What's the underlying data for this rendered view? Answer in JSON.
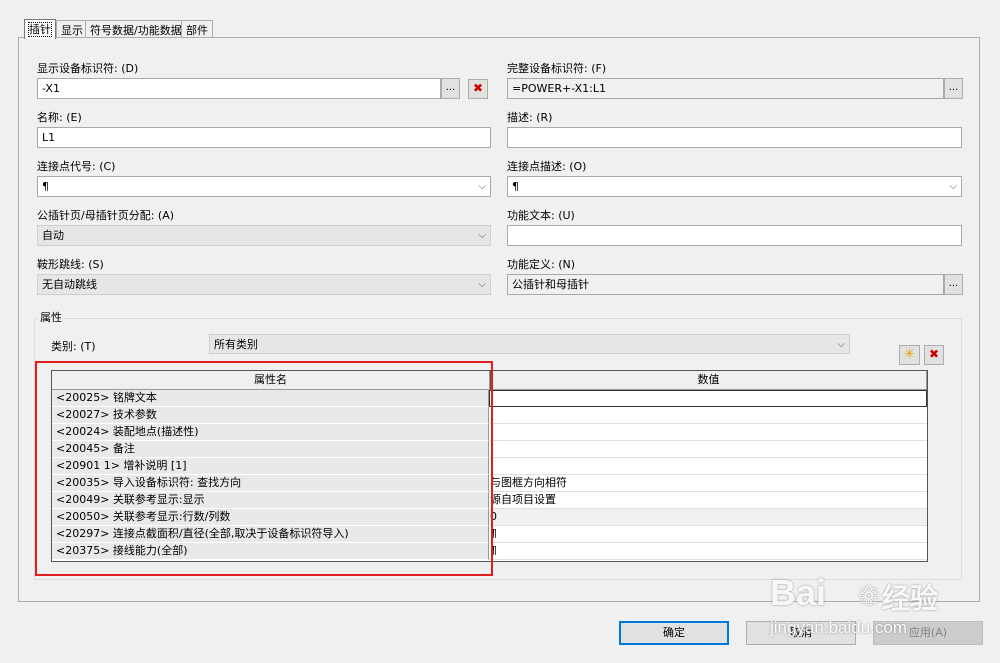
{
  "tabs": [
    "插针",
    "显示",
    "符号数据/功能数据",
    "部件"
  ],
  "fields": {
    "display_id": {
      "label": "显示设备标识符: (D)",
      "value": "-X1"
    },
    "full_id": {
      "label": "完整设备标识符: (F)",
      "value": "=POWER+-X1:L1"
    },
    "name": {
      "label": "名称: (E)",
      "value": "L1"
    },
    "description": {
      "label": "描述: (R)",
      "value": ""
    },
    "conn_code": {
      "label": "连接点代号: (C)",
      "value": "¶"
    },
    "conn_desc": {
      "label": "连接点描述: (O)",
      "value": "¶"
    },
    "page_assign": {
      "label": "公插针页/母插针页分配: (A)",
      "value": "自动"
    },
    "func_text": {
      "label": "功能文本: (U)",
      "value": ""
    },
    "jumper": {
      "label": "鞍形跳线: (S)",
      "value": "无自动跳线"
    },
    "func_def": {
      "label": "功能定义: (N)",
      "value": "公插针和母插针"
    }
  },
  "browse_label": "...",
  "delete_glyph": "✖",
  "new_glyph": "✳",
  "properties": {
    "group_title": "属性",
    "category_label": "类别: (T)",
    "category_value": "所有类别",
    "columns": [
      "属性名",
      "数值"
    ],
    "rows": [
      {
        "name": "<20025> 铭牌文本",
        "value": ""
      },
      {
        "name": "<20027> 技术参数",
        "value": ""
      },
      {
        "name": "<20024> 装配地点(描述性)",
        "value": ""
      },
      {
        "name": "<20045> 备注",
        "value": ""
      },
      {
        "name": "<20901 1> 增补说明 [1]",
        "value": ""
      },
      {
        "name": "<20035> 导入设备标识符: 查找方向",
        "value": "与图框方向相符"
      },
      {
        "name": "<20049> 关联参考显示:显示",
        "value": "源自项目设置"
      },
      {
        "name": "<20050> 关联参考显示:行数/列数",
        "value": "0"
      },
      {
        "name": "<20297> 连接点截面积/直径(全部,取决于设备标识符导入)",
        "value": "¶"
      },
      {
        "name": "<20375> 接线能力(全部)",
        "value": "¶"
      }
    ]
  },
  "buttons": {
    "ok": "确定",
    "cancel": "取消",
    "apply": "应用(A)"
  },
  "watermark": {
    "logo": "Bai",
    "brand": "经验",
    "url": "jingyan.baidu.com"
  },
  "colors": {
    "highlight_box": "#e02020",
    "delete_red": "#d00000"
  }
}
